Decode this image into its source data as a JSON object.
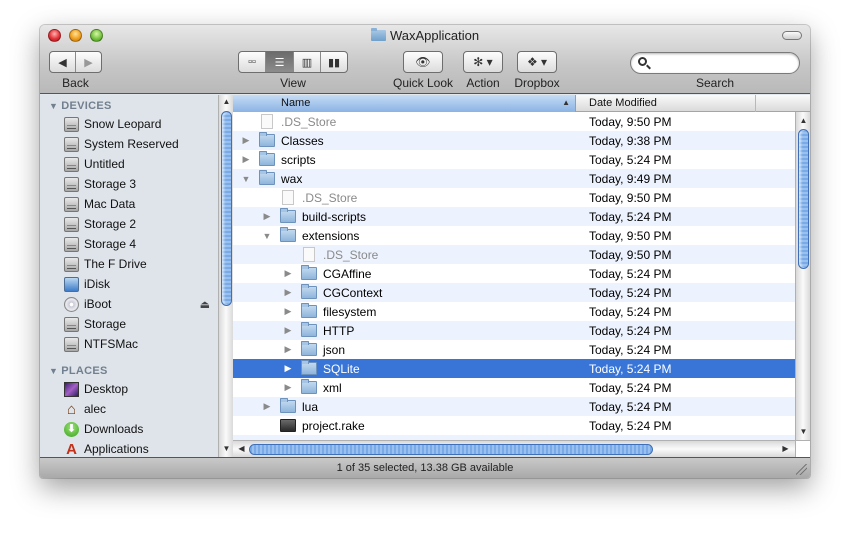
{
  "window": {
    "title": "WaxApplication",
    "title_icon": "folder-icon"
  },
  "toolbar": {
    "back_label": "Back",
    "view_label": "View",
    "quicklook_label": "Quick Look",
    "action_label": "Action",
    "dropbox_label": "Dropbox",
    "search_label": "Search",
    "search_value": "",
    "search_placeholder": "",
    "view_modes": [
      {
        "icon": "icon-view-icon",
        "glyph": "▫▫",
        "active": false
      },
      {
        "icon": "list-view-icon",
        "glyph": "☰",
        "active": true
      },
      {
        "icon": "column-view-icon",
        "glyph": "▥",
        "active": false
      },
      {
        "icon": "coverflow-view-icon",
        "glyph": "▮▮",
        "active": false
      }
    ],
    "back_glyph": "◀",
    "forward_glyph": "▶",
    "quicklook_glyph": "👁",
    "action_glyph": "✻ ▾",
    "dropbox_glyph": "❖ ▾"
  },
  "sidebar": {
    "devices_header": "DEVICES",
    "places_header": "PLACES",
    "devices": [
      {
        "label": "Snow Leopard",
        "icon": "hard-drive-icon"
      },
      {
        "label": "System Reserved",
        "icon": "hard-drive-icon"
      },
      {
        "label": "Untitled",
        "icon": "hard-drive-icon"
      },
      {
        "label": "Storage 3",
        "icon": "hard-drive-icon"
      },
      {
        "label": "Mac Data",
        "icon": "hard-drive-icon"
      },
      {
        "label": "Storage 2",
        "icon": "hard-drive-icon"
      },
      {
        "label": "Storage 4",
        "icon": "hard-drive-icon"
      },
      {
        "label": "The F Drive",
        "icon": "hard-drive-icon"
      },
      {
        "label": "iDisk",
        "icon": "idisk-icon"
      },
      {
        "label": "iBoot",
        "icon": "optical-disc-icon",
        "ejectable": true
      },
      {
        "label": "Storage",
        "icon": "hard-drive-icon"
      },
      {
        "label": "NTFSMac",
        "icon": "hard-drive-icon"
      }
    ],
    "places": [
      {
        "label": "Desktop",
        "icon": "desktop-icon"
      },
      {
        "label": "alec",
        "icon": "home-icon"
      },
      {
        "label": "Downloads",
        "icon": "downloads-icon"
      },
      {
        "label": "Applications",
        "icon": "applications-icon"
      }
    ]
  },
  "filelist": {
    "columns": {
      "name": "Name",
      "date": "Date Modified"
    },
    "sort_indicator": "▲",
    "rows": [
      {
        "name": ".DS_Store",
        "date": "Today, 9:50 PM",
        "depth": 0,
        "type": "file",
        "disclosure": "none",
        "dim": true
      },
      {
        "name": "Classes",
        "date": "Today, 9:38 PM",
        "depth": 0,
        "type": "folder",
        "disclosure": "collapsed"
      },
      {
        "name": "scripts",
        "date": "Today, 5:24 PM",
        "depth": 0,
        "type": "folder",
        "disclosure": "collapsed"
      },
      {
        "name": "wax",
        "date": "Today, 9:49 PM",
        "depth": 0,
        "type": "folder",
        "disclosure": "expanded"
      },
      {
        "name": ".DS_Store",
        "date": "Today, 9:50 PM",
        "depth": 1,
        "type": "file",
        "disclosure": "none",
        "dim": true
      },
      {
        "name": "build-scripts",
        "date": "Today, 5:24 PM",
        "depth": 1,
        "type": "folder",
        "disclosure": "collapsed"
      },
      {
        "name": "extensions",
        "date": "Today, 9:50 PM",
        "depth": 1,
        "type": "folder",
        "disclosure": "expanded"
      },
      {
        "name": ".DS_Store",
        "date": "Today, 9:50 PM",
        "depth": 2,
        "type": "file",
        "disclosure": "none",
        "dim": true
      },
      {
        "name": "CGAffine",
        "date": "Today, 5:24 PM",
        "depth": 2,
        "type": "folder",
        "disclosure": "collapsed"
      },
      {
        "name": "CGContext",
        "date": "Today, 5:24 PM",
        "depth": 2,
        "type": "folder",
        "disclosure": "collapsed"
      },
      {
        "name": "filesystem",
        "date": "Today, 5:24 PM",
        "depth": 2,
        "type": "folder",
        "disclosure": "collapsed"
      },
      {
        "name": "HTTP",
        "date": "Today, 5:24 PM",
        "depth": 2,
        "type": "folder",
        "disclosure": "collapsed"
      },
      {
        "name": "json",
        "date": "Today, 5:24 PM",
        "depth": 2,
        "type": "folder",
        "disclosure": "collapsed"
      },
      {
        "name": "SQLite",
        "date": "Today, 5:24 PM",
        "depth": 2,
        "type": "folder",
        "disclosure": "collapsed",
        "selected": true
      },
      {
        "name": "xml",
        "date": "Today, 5:24 PM",
        "depth": 2,
        "type": "folder",
        "disclosure": "collapsed"
      },
      {
        "name": "lua",
        "date": "Today, 5:24 PM",
        "depth": 1,
        "type": "folder",
        "disclosure": "collapsed"
      },
      {
        "name": "project.rake",
        "date": "Today, 5:24 PM",
        "depth": 1,
        "type": "rake",
        "disclosure": "none"
      }
    ]
  },
  "scroll": {
    "up_glyph": "▲",
    "down_glyph": "▼",
    "left_glyph": "◀",
    "right_glyph": "▶"
  },
  "status": {
    "text": "1 of 35 selected, 13.38 GB available"
  },
  "colors": {
    "selection": "#3875d7",
    "alternate_row": "#edf3fe",
    "sidebar_bg": "#dfe4ea",
    "section_header": "#717f8e"
  }
}
